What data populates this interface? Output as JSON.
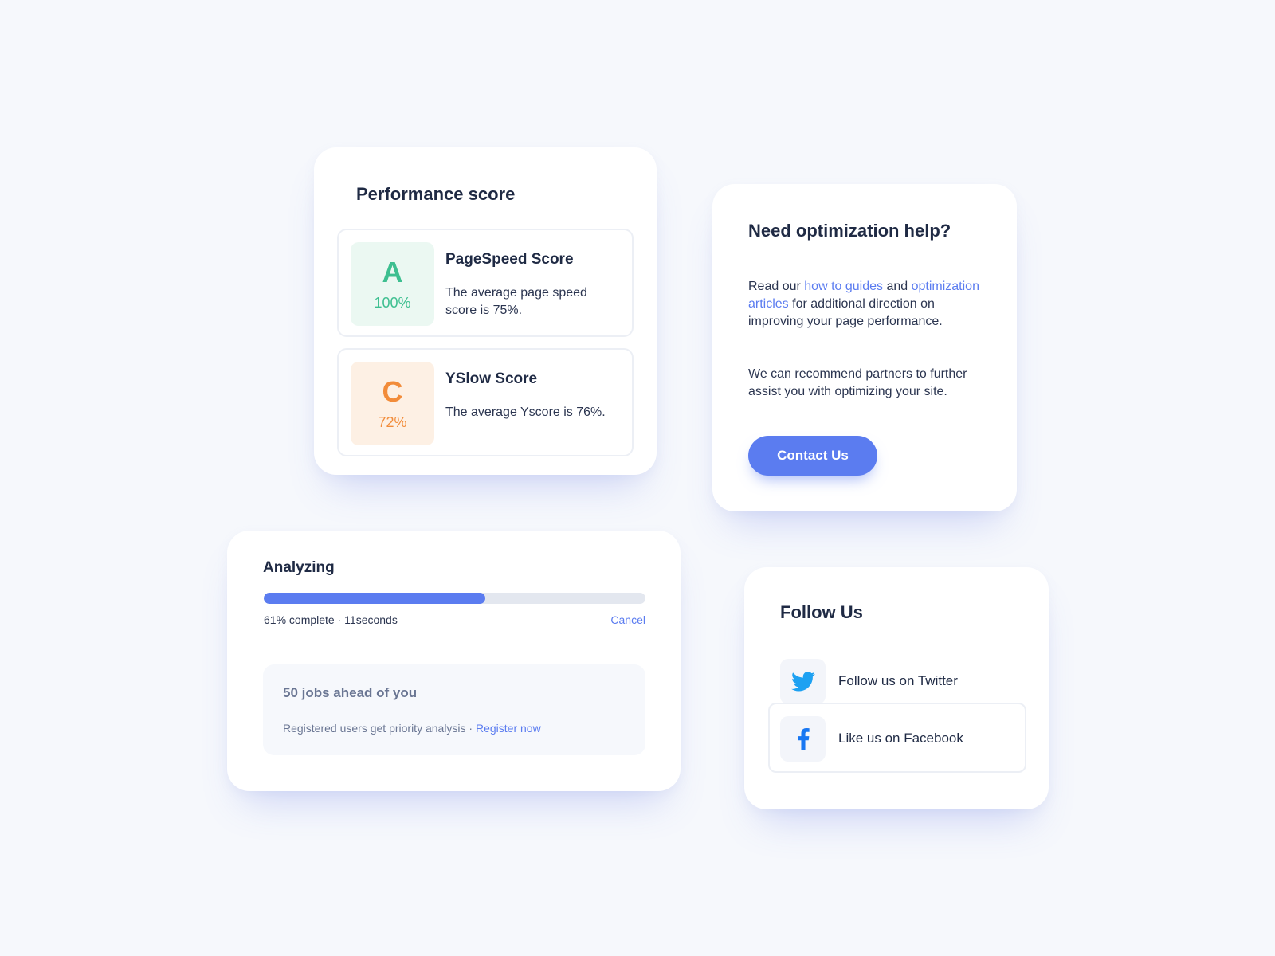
{
  "performance": {
    "title": "Performance score",
    "scores": [
      {
        "grade": "A",
        "percent": "100%",
        "name": "PageSpeed Score",
        "description": "The average page speed score is 75%."
      },
      {
        "grade": "C",
        "percent": "72%",
        "name": "YSlow Score",
        "description": "The average Yscore is 76%."
      }
    ]
  },
  "help": {
    "title": "Need optimization help?",
    "p1_prefix": "Read our ",
    "link_guides": "how to guides",
    "p1_mid": " and ",
    "link_articles": "optimization articles",
    "p1_suffix": " for additional direction on improving your page performance.",
    "p2": "We can recommend partners to further assist you with optimizing your site.",
    "button": "Contact Us"
  },
  "analyzing": {
    "title": "Analyzing",
    "progress_fraction": 0.58,
    "status": "61% complete · 11seconds",
    "cancel": "Cancel",
    "queue_title": "50 jobs ahead of you",
    "queue_note": "Registered users get priority analysis · ",
    "register_link": "Register now"
  },
  "follow": {
    "title": "Follow Us",
    "twitter_label": "Follow us on Twitter",
    "facebook_label": "Like us on Facebook"
  },
  "colors": {
    "accent": "#5b7cf0",
    "grade_a": "#3dbf90",
    "grade_c": "#f28c3a",
    "twitter": "#1da1f2",
    "facebook": "#1877f2"
  },
  "icons": {
    "twitter": "twitter-icon",
    "facebook": "facebook-icon"
  }
}
